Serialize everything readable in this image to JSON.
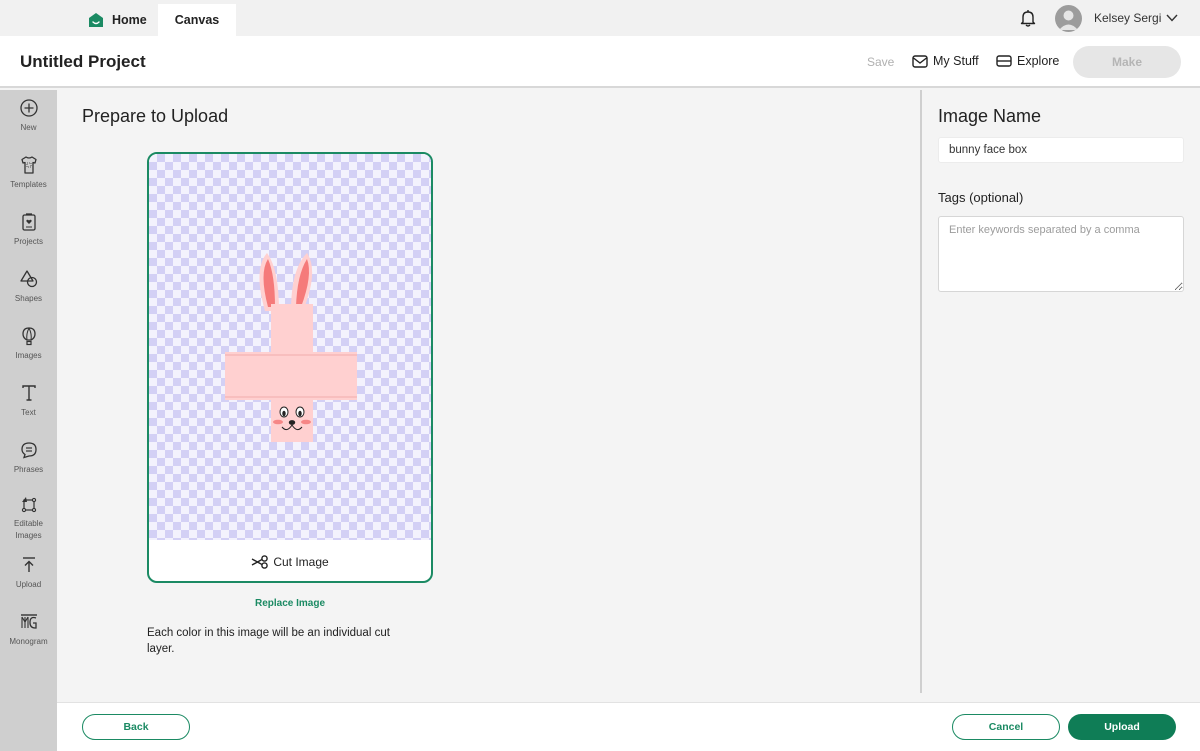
{
  "topbar": {
    "tabs": [
      {
        "label": "Home",
        "icon": "home-icon"
      },
      {
        "label": "Canvas"
      }
    ],
    "user": {
      "name": "Kelsey Sergi",
      "icons": [
        "bell-icon",
        "avatar-icon",
        "chevron-down-icon"
      ]
    }
  },
  "header": {
    "project_title": "Untitled Project",
    "save_label": "Save",
    "my_stuff_label": "My Stuff",
    "explore_label": "Explore",
    "make_label": "Make"
  },
  "sidebar": {
    "items": [
      {
        "label": "New",
        "icon": "plus-circle-icon"
      },
      {
        "label": "Templates",
        "icon": "shirt-icon"
      },
      {
        "label": "Projects",
        "icon": "project-icon"
      },
      {
        "label": "Shapes",
        "icon": "shapes-icon"
      },
      {
        "label": "Images",
        "icon": "balloon-icon"
      },
      {
        "label": "Text",
        "icon": "text-icon"
      },
      {
        "label": "Phrases",
        "icon": "speech-bubble-icon"
      },
      {
        "label": "Editable Images",
        "icon": "editable-images-icon"
      },
      {
        "label": "Upload",
        "icon": "upload-icon"
      },
      {
        "label": "Monogram",
        "icon": "monogram-icon"
      }
    ]
  },
  "main": {
    "title": "Prepare to Upload",
    "cut_image_label": "Cut Image",
    "replace_image_label": "Replace Image",
    "note": "Each color in this image will be an individual cut layer.",
    "colors": {
      "accent": "#1b8a63",
      "bunny_pink": "#ffd3d3",
      "ear_inner": "#f57a7a"
    }
  },
  "right_panel": {
    "image_name_label": "Image Name",
    "image_name_value": "bunny face box",
    "tags_label": "Tags (optional)",
    "tags_placeholder": "Enter keywords separated by a comma",
    "tags_value": ""
  },
  "footer": {
    "back_label": "Back",
    "cancel_label": "Cancel",
    "upload_label": "Upload"
  }
}
